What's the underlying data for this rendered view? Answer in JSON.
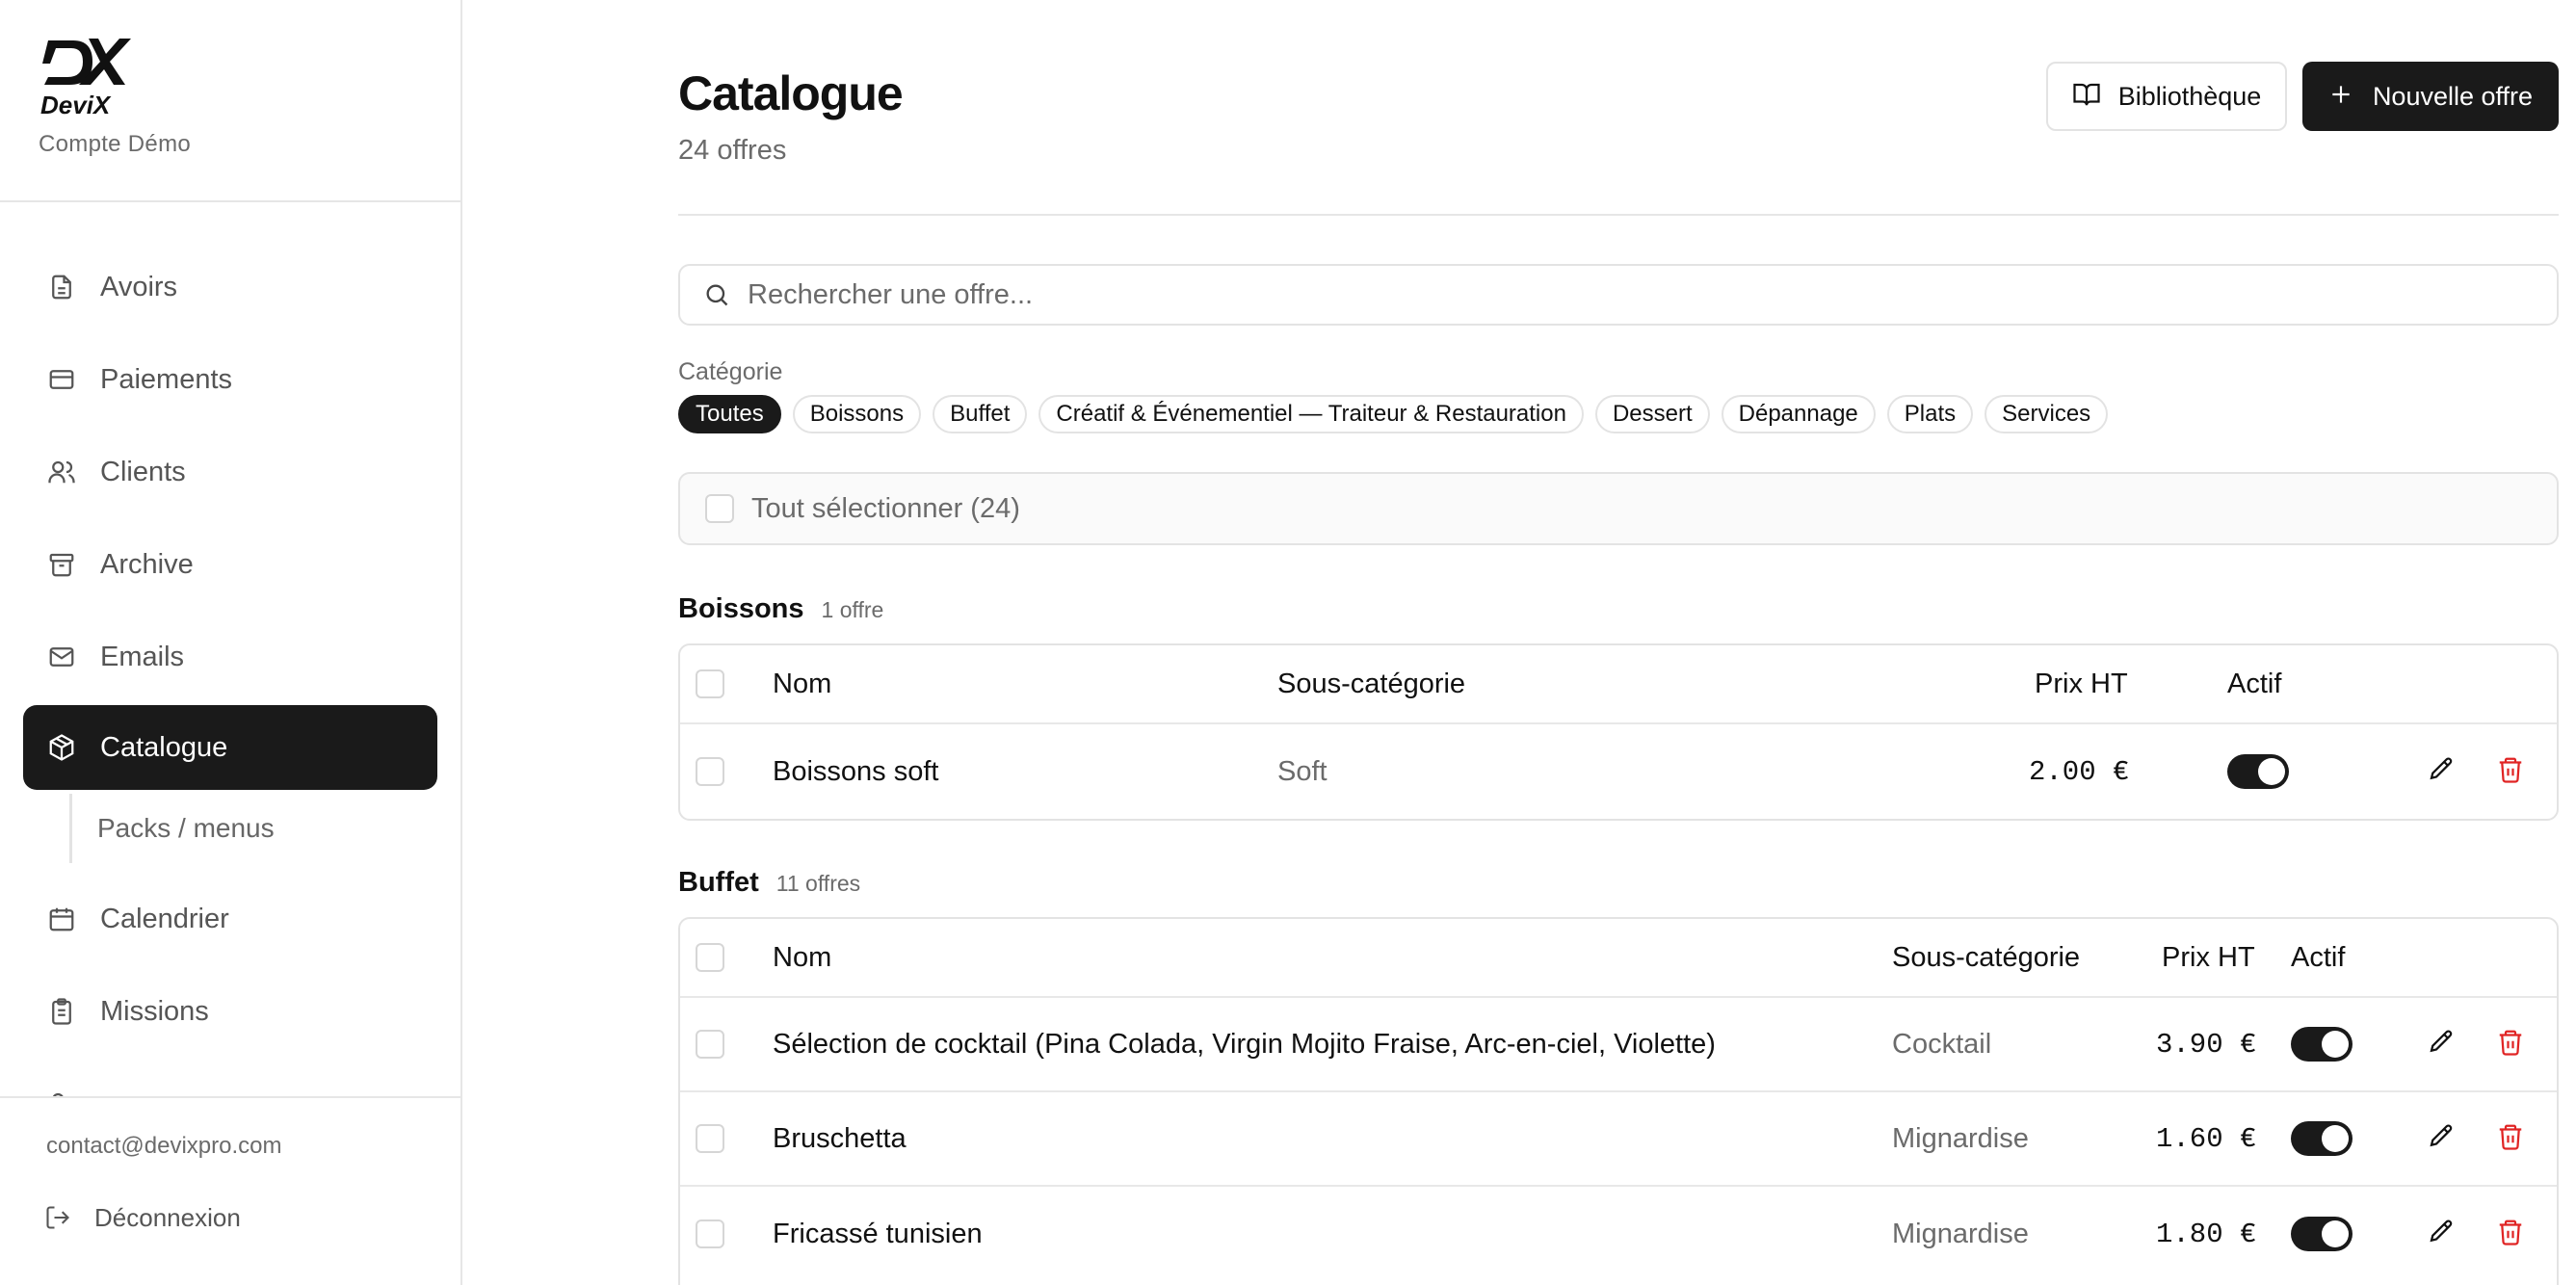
{
  "brand": {
    "logo_text": "DeviX",
    "account_name": "Compte Démo"
  },
  "sidebar": {
    "items": [
      {
        "label": "Avoirs",
        "icon": "file-icon"
      },
      {
        "label": "Paiements",
        "icon": "credit-card-icon"
      },
      {
        "label": "Clients",
        "icon": "users-icon"
      },
      {
        "label": "Archive",
        "icon": "archive-icon"
      },
      {
        "label": "Emails",
        "icon": "mail-icon"
      },
      {
        "label": "Catalogue",
        "icon": "package-icon",
        "active": true
      },
      {
        "label": "Calendrier",
        "icon": "calendar-icon"
      },
      {
        "label": "Missions",
        "icon": "clipboard-icon"
      }
    ],
    "sub_items": [
      {
        "label": "Packs / menus"
      }
    ],
    "contact_email": "contact@devixpro.com",
    "logout_label": "Déconnexion"
  },
  "header": {
    "title": "Catalogue",
    "count": "24 offres",
    "library_label": "Bibliothèque",
    "new_offer_label": "Nouvelle offre"
  },
  "search": {
    "placeholder": "Rechercher une offre..."
  },
  "filters": {
    "label": "Catégorie",
    "chips": [
      {
        "label": "Toutes",
        "active": true
      },
      {
        "label": "Boissons"
      },
      {
        "label": "Buffet"
      },
      {
        "label": "Créatif & Événementiel — Traiteur & Restauration"
      },
      {
        "label": "Dessert"
      },
      {
        "label": "Dépannage"
      },
      {
        "label": "Plats"
      },
      {
        "label": "Services"
      }
    ]
  },
  "select_all_label": "Tout sélectionner (24)",
  "columns": {
    "name": "Nom",
    "subcategory": "Sous-catégorie",
    "price": "Prix HT",
    "active": "Actif"
  },
  "groups": [
    {
      "name": "Boissons",
      "count": "1 offre",
      "rows": [
        {
          "name": "Boissons soft",
          "subcategory": "Soft",
          "price": "2.00 €",
          "active": true
        }
      ]
    },
    {
      "name": "Buffet",
      "count": "11 offres",
      "rows": [
        {
          "name": "Sélection de cocktail (Pina Colada, Virgin Mojito Fraise, Arc-en-ciel, Violette)",
          "subcategory": "Cocktail",
          "price": "3.90 €",
          "active": true
        },
        {
          "name": "Bruschetta",
          "subcategory": "Mignardise",
          "price": "1.60 €",
          "active": true
        },
        {
          "name": "Fricassé tunisien",
          "subcategory": "Mignardise",
          "price": "1.80 €",
          "active": true
        }
      ]
    }
  ],
  "colors": {
    "primary": "#1a1a1a",
    "danger": "#e02424",
    "muted": "#6b6b6b",
    "border": "#e3e3e3"
  }
}
